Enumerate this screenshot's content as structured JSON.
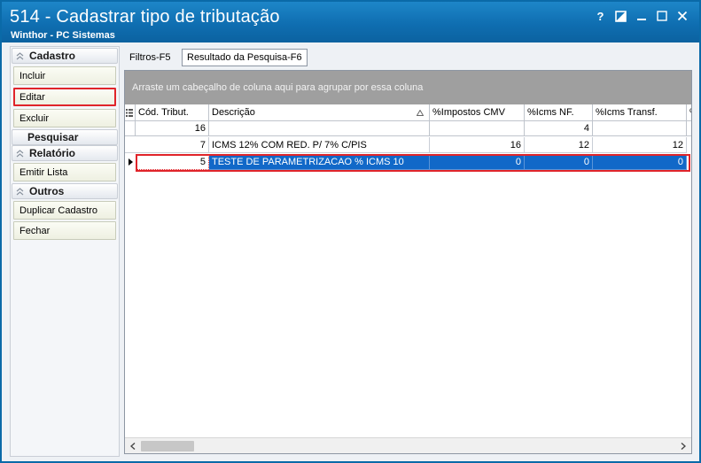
{
  "window": {
    "title": "514 - Cadastrar tipo de tributação",
    "subtitle": "Winthor - PC Sistemas",
    "controls": [
      "?",
      "⧄",
      "—",
      "☐",
      "✕"
    ]
  },
  "sidebar": {
    "groups": [
      {
        "label": "Cadastro",
        "items": [
          "Incluir",
          "Editar",
          "Excluir"
        ]
      },
      {
        "label": "Pesquisar",
        "items": []
      },
      {
        "label": "Relatório",
        "items": [
          "Emitir Lista"
        ]
      },
      {
        "label": "Outros",
        "items": [
          "Duplicar Cadastro",
          "Fechar"
        ]
      }
    ]
  },
  "tabs": [
    "Filtros-F5",
    "Resultado da Pesquisa-F6"
  ],
  "grid": {
    "group_hint": "Arraste um cabeçalho de coluna aqui para agrupar por essa coluna",
    "columns": [
      "Cód. Tribut.",
      "Descrição",
      "%Impostos CMV",
      "%Icms NF.",
      "%Icms Transf.",
      "%"
    ],
    "filter_row": [
      "16",
      "",
      "",
      "4",
      "",
      ""
    ],
    "rows": [
      [
        "7",
        "ICMS 12% COM RED. P/ 7% C/PIS",
        "16",
        "12",
        "12"
      ],
      [
        "5",
        "TESTE DE PARAMETRIZACAO % ICMS 10",
        "0",
        "0",
        "0"
      ]
    ]
  }
}
